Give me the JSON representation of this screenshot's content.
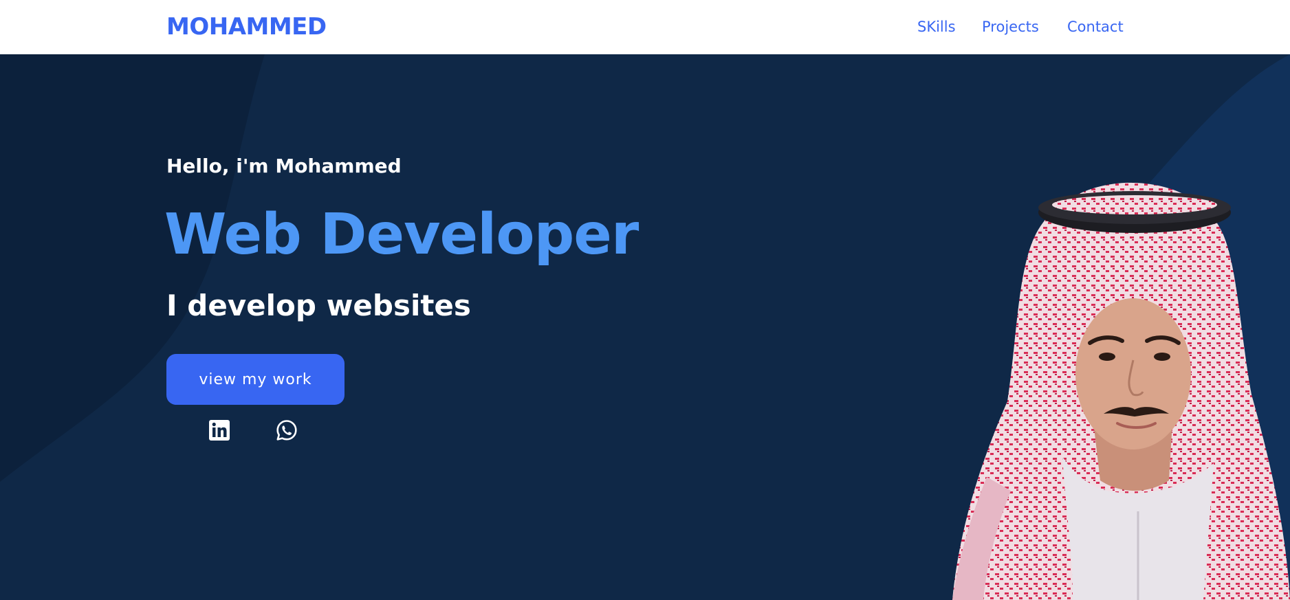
{
  "brand": {
    "logo": "MOHAMMED"
  },
  "nav": {
    "items": [
      {
        "label": "SKills"
      },
      {
        "label": "Projects"
      },
      {
        "label": "Contact"
      }
    ]
  },
  "hero": {
    "greeting": "Hello, i'm Mohammed",
    "headline": "Web Developer",
    "subheadline": "I develop websites",
    "cta_label": "view my work",
    "social": [
      {
        "icon": "linkedin-icon"
      },
      {
        "icon": "whatsapp-icon"
      }
    ]
  },
  "colors": {
    "accent": "#3866f2",
    "headline": "#4d97f5",
    "background": "#0f2847",
    "navbar": "#ffffff"
  }
}
